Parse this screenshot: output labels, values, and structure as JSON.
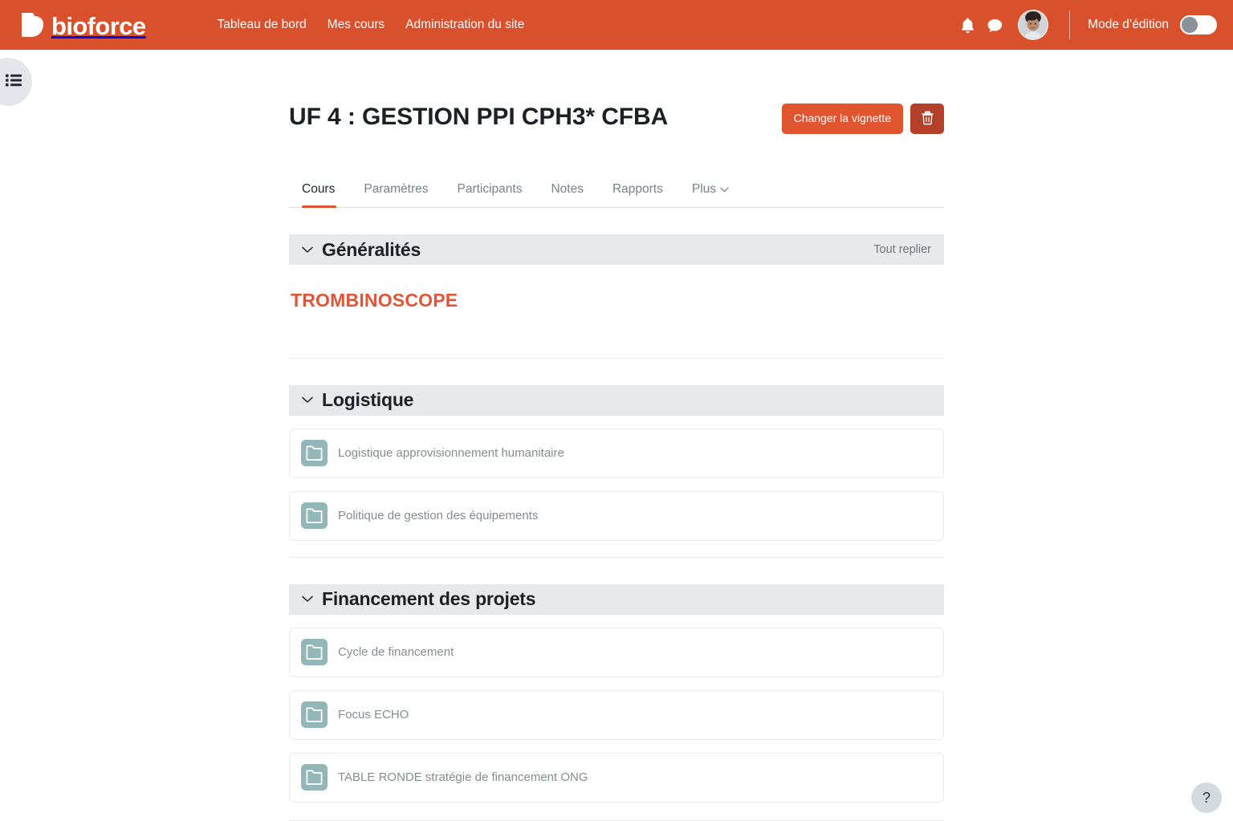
{
  "brand": {
    "name": "bioforce",
    "logo_icon": "bioforce-leaf-logo"
  },
  "navbar": {
    "links": [
      {
        "label": "Tableau de bord"
      },
      {
        "label": "Mes cours"
      },
      {
        "label": "Administration du site"
      }
    ],
    "notifications_icon": "bell-icon",
    "messages_icon": "message-bubble-icon",
    "avatar_icon": "user-avatar",
    "edit_mode_label": "Mode d’édition",
    "edit_mode_on": false,
    "accent_color": "#d9512c"
  },
  "drawer": {
    "toggle_icon": "course-index-list-icon"
  },
  "course": {
    "title": "UF 4 : GESTION PPI CPH3* CFBA",
    "change_thumbnail_label": "Changer la vignette",
    "delete_icon": "trash-icon",
    "primary_color": "#e0542f",
    "danger_color": "#b5402a"
  },
  "tabs": [
    {
      "label": "Cours",
      "active": true
    },
    {
      "label": "Paramètres",
      "active": false
    },
    {
      "label": "Participants",
      "active": false
    },
    {
      "label": "Notes",
      "active": false
    },
    {
      "label": "Rapports",
      "active": false
    },
    {
      "label": "Plus",
      "active": false,
      "icon": "chevron-down-icon"
    }
  ],
  "sections": [
    {
      "title": "Généralités",
      "collapse_all_label": "Tout replier",
      "summary_heading": "TROMBINOSCOPE",
      "summary_color": "#e0553a",
      "activities": []
    },
    {
      "title": "Logistique",
      "collapse_all_label": "",
      "summary_heading": "",
      "activities": [
        {
          "name": "Logistique approvisionnement humanitaire",
          "icon": "folder-icon"
        },
        {
          "name": "Politique de gestion des équipements",
          "icon": "folder-icon"
        }
      ]
    },
    {
      "title": "Financement des projets",
      "collapse_all_label": "",
      "summary_heading": "",
      "activities": [
        {
          "name": "Cycle de financement",
          "icon": "folder-icon"
        },
        {
          "name": "Focus ECHO",
          "icon": "folder-icon"
        },
        {
          "name": "TABLE RONDE stratégie de financement ONG",
          "icon": "folder-icon"
        }
      ]
    }
  ],
  "help": {
    "label": "?",
    "icon": "question-mark-icon"
  }
}
